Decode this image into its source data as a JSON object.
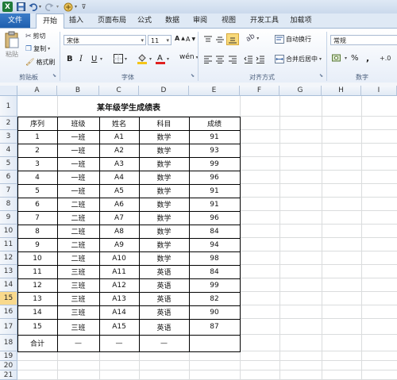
{
  "titlebar": {
    "quick_access": [
      "excel-logo-icon",
      "save-icon",
      "undo-icon",
      "redo-icon",
      "custom-icon",
      "customize-arrow-icon"
    ]
  },
  "tabs": [
    "文件",
    "开始",
    "插入",
    "页面布局",
    "公式",
    "数据",
    "审阅",
    "视图",
    "开发工具",
    "加载项"
  ],
  "ribbon": {
    "clipboard": {
      "paste": "粘贴",
      "cut": "剪切",
      "copy": "复制",
      "format_painter": "格式刷",
      "group": "剪贴板"
    },
    "font": {
      "name": "宋体",
      "size": "11",
      "group": "字体",
      "bold": "B",
      "italic": "I",
      "underline": "U"
    },
    "alignment": {
      "wrap": "自动换行",
      "merge": "合并后居中",
      "group": "对齐方式"
    },
    "number": {
      "format": "常规",
      "percent": "%",
      "comma": ",",
      "group": "数字"
    }
  },
  "colors": {
    "accent": "#1f5fae",
    "selected_row": "#f9d98c",
    "grid": "#dadcdd",
    "fill_highlight": "#f5c518",
    "font_color": "#e02020"
  },
  "sheet": {
    "columns": [
      "A",
      "B",
      "C",
      "D",
      "E",
      "F",
      "G",
      "H",
      "I"
    ],
    "rows": [
      "1",
      "2",
      "3",
      "4",
      "5",
      "6",
      "7",
      "8",
      "9",
      "10",
      "11",
      "12",
      "13",
      "14",
      "15",
      "16",
      "17",
      "18",
      "19",
      "20",
      "21"
    ],
    "selected_row": "15",
    "title": "某年级学生成绩表",
    "headers": [
      "序列",
      "班级",
      "姓名",
      "科目",
      "成绩"
    ],
    "data": [
      [
        "1",
        "一班",
        "A1",
        "数学",
        "91"
      ],
      [
        "2",
        "一班",
        "A2",
        "数学",
        "93"
      ],
      [
        "3",
        "一班",
        "A3",
        "数学",
        "99"
      ],
      [
        "4",
        "一班",
        "A4",
        "数学",
        "96"
      ],
      [
        "5",
        "一班",
        "A5",
        "数学",
        "91"
      ],
      [
        "6",
        "二班",
        "A6",
        "数学",
        "91"
      ],
      [
        "7",
        "二班",
        "A7",
        "数学",
        "96"
      ],
      [
        "8",
        "二班",
        "A8",
        "数学",
        "84"
      ],
      [
        "9",
        "二班",
        "A9",
        "数学",
        "94"
      ],
      [
        "10",
        "二班",
        "A10",
        "数学",
        "98"
      ],
      [
        "11",
        "三班",
        "A11",
        "英语",
        "84"
      ],
      [
        "12",
        "三班",
        "A12",
        "英语",
        "99"
      ],
      [
        "13",
        "三班",
        "A13",
        "英语",
        "82"
      ],
      [
        "14",
        "三班",
        "A14",
        "英语",
        "90"
      ],
      [
        "15",
        "三班",
        "A15",
        "英语",
        "87"
      ]
    ],
    "total": [
      "合计",
      "—",
      "—",
      "—",
      ""
    ]
  }
}
